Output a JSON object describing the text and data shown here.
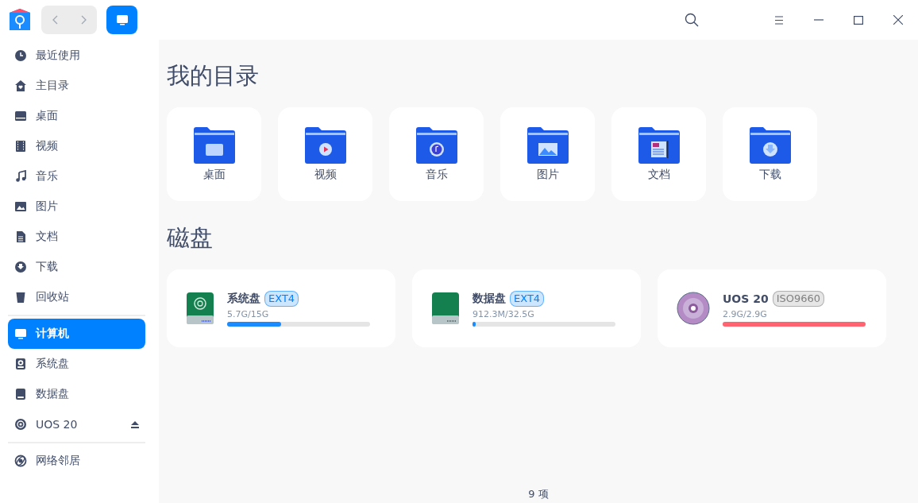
{
  "sidebar": {
    "groups": [
      {
        "items": [
          {
            "label": "最近使用",
            "selected": false
          },
          {
            "label": "主目录",
            "selected": false
          },
          {
            "label": "桌面",
            "selected": false
          },
          {
            "label": "视频",
            "selected": false
          },
          {
            "label": "音乐",
            "selected": false
          },
          {
            "label": "图片",
            "selected": false
          },
          {
            "label": "文档",
            "selected": false
          },
          {
            "label": "下载",
            "selected": false
          },
          {
            "label": "回收站",
            "selected": false
          }
        ]
      },
      {
        "items": [
          {
            "label": "计算机",
            "selected": true
          },
          {
            "label": "系统盘",
            "selected": false
          },
          {
            "label": "数据盘",
            "selected": false
          },
          {
            "label": "UOS 20",
            "selected": false,
            "ejectable": true
          }
        ]
      },
      {
        "items": [
          {
            "label": "网络邻居",
            "selected": false
          }
        ]
      }
    ]
  },
  "directories": {
    "title": "我的目录",
    "items": [
      {
        "label": "桌面"
      },
      {
        "label": "视频"
      },
      {
        "label": "音乐"
      },
      {
        "label": "图片"
      },
      {
        "label": "文档"
      },
      {
        "label": "下载"
      }
    ]
  },
  "disks": {
    "title": "磁盘",
    "items": [
      {
        "kind": "system",
        "name": "系统盘",
        "tag": {
          "text": "EXT4",
          "color": "#0081ff"
        },
        "usage": "5.7G/15G",
        "level": 0.38,
        "color": "#1a8cff"
      },
      {
        "kind": "data",
        "name": "数据盘",
        "tag": {
          "text": "EXT4",
          "color": "#0081ff"
        },
        "usage": "912.3M/32.5G",
        "level": 0.02,
        "color": "#1a8cff"
      },
      {
        "kind": "optical",
        "name": "UOS 20",
        "tag": {
          "text": "ISO9660",
          "color": "#808080"
        },
        "usage": "2.9G/2.9G",
        "level": 1,
        "color": "#ff6470"
      }
    ]
  },
  "status_bar": {
    "count": "9 项"
  }
}
